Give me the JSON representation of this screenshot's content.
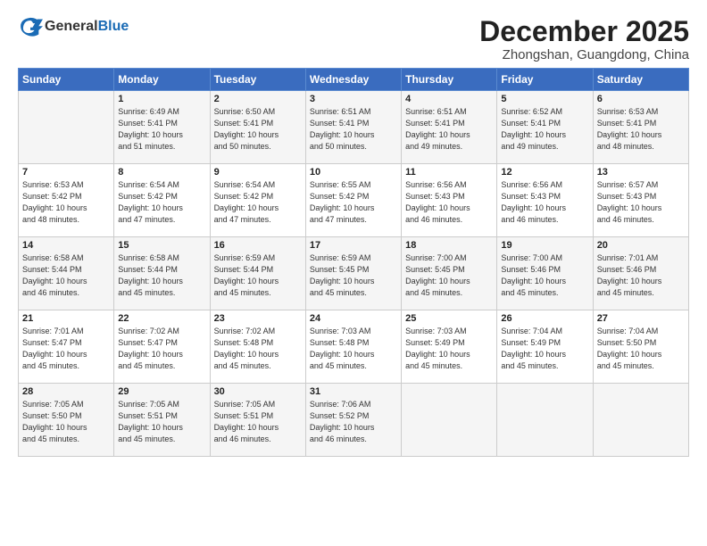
{
  "header": {
    "logo_general": "General",
    "logo_blue": "Blue",
    "month": "December 2025",
    "location": "Zhongshan, Guangdong, China"
  },
  "weekdays": [
    "Sunday",
    "Monday",
    "Tuesday",
    "Wednesday",
    "Thursday",
    "Friday",
    "Saturday"
  ],
  "weeks": [
    [
      {
        "day": "",
        "info": ""
      },
      {
        "day": "1",
        "info": "Sunrise: 6:49 AM\nSunset: 5:41 PM\nDaylight: 10 hours\nand 51 minutes."
      },
      {
        "day": "2",
        "info": "Sunrise: 6:50 AM\nSunset: 5:41 PM\nDaylight: 10 hours\nand 50 minutes."
      },
      {
        "day": "3",
        "info": "Sunrise: 6:51 AM\nSunset: 5:41 PM\nDaylight: 10 hours\nand 50 minutes."
      },
      {
        "day": "4",
        "info": "Sunrise: 6:51 AM\nSunset: 5:41 PM\nDaylight: 10 hours\nand 49 minutes."
      },
      {
        "day": "5",
        "info": "Sunrise: 6:52 AM\nSunset: 5:41 PM\nDaylight: 10 hours\nand 49 minutes."
      },
      {
        "day": "6",
        "info": "Sunrise: 6:53 AM\nSunset: 5:41 PM\nDaylight: 10 hours\nand 48 minutes."
      }
    ],
    [
      {
        "day": "7",
        "info": "Sunrise: 6:53 AM\nSunset: 5:42 PM\nDaylight: 10 hours\nand 48 minutes."
      },
      {
        "day": "8",
        "info": "Sunrise: 6:54 AM\nSunset: 5:42 PM\nDaylight: 10 hours\nand 47 minutes."
      },
      {
        "day": "9",
        "info": "Sunrise: 6:54 AM\nSunset: 5:42 PM\nDaylight: 10 hours\nand 47 minutes."
      },
      {
        "day": "10",
        "info": "Sunrise: 6:55 AM\nSunset: 5:42 PM\nDaylight: 10 hours\nand 47 minutes."
      },
      {
        "day": "11",
        "info": "Sunrise: 6:56 AM\nSunset: 5:43 PM\nDaylight: 10 hours\nand 46 minutes."
      },
      {
        "day": "12",
        "info": "Sunrise: 6:56 AM\nSunset: 5:43 PM\nDaylight: 10 hours\nand 46 minutes."
      },
      {
        "day": "13",
        "info": "Sunrise: 6:57 AM\nSunset: 5:43 PM\nDaylight: 10 hours\nand 46 minutes."
      }
    ],
    [
      {
        "day": "14",
        "info": "Sunrise: 6:58 AM\nSunset: 5:44 PM\nDaylight: 10 hours\nand 46 minutes."
      },
      {
        "day": "15",
        "info": "Sunrise: 6:58 AM\nSunset: 5:44 PM\nDaylight: 10 hours\nand 45 minutes."
      },
      {
        "day": "16",
        "info": "Sunrise: 6:59 AM\nSunset: 5:44 PM\nDaylight: 10 hours\nand 45 minutes."
      },
      {
        "day": "17",
        "info": "Sunrise: 6:59 AM\nSunset: 5:45 PM\nDaylight: 10 hours\nand 45 minutes."
      },
      {
        "day": "18",
        "info": "Sunrise: 7:00 AM\nSunset: 5:45 PM\nDaylight: 10 hours\nand 45 minutes."
      },
      {
        "day": "19",
        "info": "Sunrise: 7:00 AM\nSunset: 5:46 PM\nDaylight: 10 hours\nand 45 minutes."
      },
      {
        "day": "20",
        "info": "Sunrise: 7:01 AM\nSunset: 5:46 PM\nDaylight: 10 hours\nand 45 minutes."
      }
    ],
    [
      {
        "day": "21",
        "info": "Sunrise: 7:01 AM\nSunset: 5:47 PM\nDaylight: 10 hours\nand 45 minutes."
      },
      {
        "day": "22",
        "info": "Sunrise: 7:02 AM\nSunset: 5:47 PM\nDaylight: 10 hours\nand 45 minutes."
      },
      {
        "day": "23",
        "info": "Sunrise: 7:02 AM\nSunset: 5:48 PM\nDaylight: 10 hours\nand 45 minutes."
      },
      {
        "day": "24",
        "info": "Sunrise: 7:03 AM\nSunset: 5:48 PM\nDaylight: 10 hours\nand 45 minutes."
      },
      {
        "day": "25",
        "info": "Sunrise: 7:03 AM\nSunset: 5:49 PM\nDaylight: 10 hours\nand 45 minutes."
      },
      {
        "day": "26",
        "info": "Sunrise: 7:04 AM\nSunset: 5:49 PM\nDaylight: 10 hours\nand 45 minutes."
      },
      {
        "day": "27",
        "info": "Sunrise: 7:04 AM\nSunset: 5:50 PM\nDaylight: 10 hours\nand 45 minutes."
      }
    ],
    [
      {
        "day": "28",
        "info": "Sunrise: 7:05 AM\nSunset: 5:50 PM\nDaylight: 10 hours\nand 45 minutes."
      },
      {
        "day": "29",
        "info": "Sunrise: 7:05 AM\nSunset: 5:51 PM\nDaylight: 10 hours\nand 45 minutes."
      },
      {
        "day": "30",
        "info": "Sunrise: 7:05 AM\nSunset: 5:51 PM\nDaylight: 10 hours\nand 46 minutes."
      },
      {
        "day": "31",
        "info": "Sunrise: 7:06 AM\nSunset: 5:52 PM\nDaylight: 10 hours\nand 46 minutes."
      },
      {
        "day": "",
        "info": ""
      },
      {
        "day": "",
        "info": ""
      },
      {
        "day": "",
        "info": ""
      }
    ]
  ]
}
